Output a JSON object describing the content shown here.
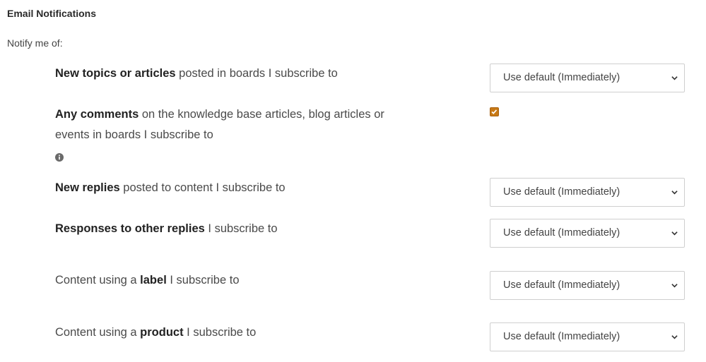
{
  "section": {
    "title": "Email Notifications",
    "notify_label": "Notify me of:"
  },
  "rows": [
    {
      "bold": "New topics or articles",
      "rest": " posted in boards I subscribe to",
      "select_value": "Use default (Immediately)"
    },
    {
      "bold": "Any comments",
      "rest": " on the knowledge base articles, blog articles or events in boards I subscribe to",
      "checked": true,
      "info_icon": "info-circle-icon"
    },
    {
      "bold": "New replies",
      "rest": " posted to content I subscribe to",
      "select_value": "Use default (Immediately)"
    },
    {
      "bold": "Responses to other replies",
      "rest": " I subscribe to",
      "select_value": "Use default (Immediately)"
    },
    {
      "pre": "Content using a ",
      "bold": "label",
      "rest": " I subscribe to",
      "select_value": "Use default (Immediately)"
    },
    {
      "pre": "Content using a ",
      "bold": "product",
      "rest": " I subscribe to",
      "select_value": "Use default (Immediately)"
    }
  ],
  "colors": {
    "checkbox_accent": "#c77916",
    "select_border": "#cfcfcf",
    "text_dark": "#222222",
    "text_regular": "#4a4a4a"
  },
  "icons": {
    "select_chevron": "chevron-down-icon",
    "checkbox_mark": "checkmark-icon"
  }
}
